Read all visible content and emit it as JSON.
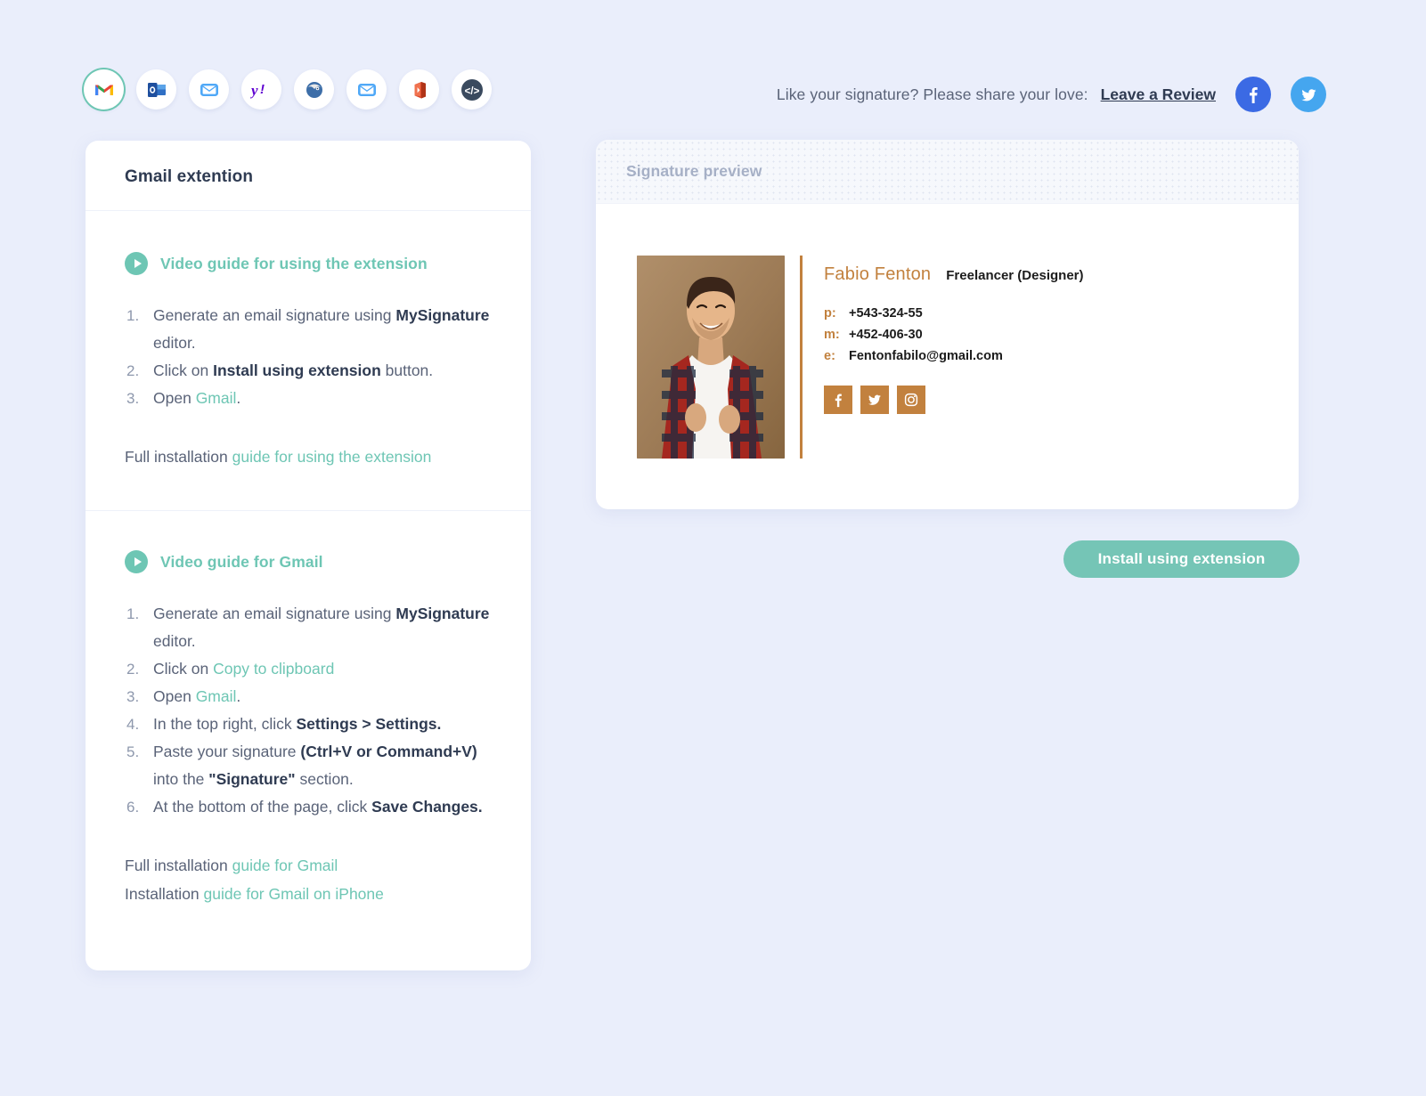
{
  "topbar": {
    "clients": [
      {
        "name": "gmail",
        "label": "Gmail",
        "active": true
      },
      {
        "name": "outlook",
        "label": "Outlook",
        "active": false
      },
      {
        "name": "apple-mail",
        "label": "Apple Mail",
        "active": false
      },
      {
        "name": "yahoo-mail",
        "label": "Yahoo Mail",
        "active": false
      },
      {
        "name": "thunderbird",
        "label": "Thunderbird",
        "active": false
      },
      {
        "name": "mail-app",
        "label": "Mail",
        "active": false
      },
      {
        "name": "office-365",
        "label": "Office 365",
        "active": false
      },
      {
        "name": "html-code",
        "label": "HTML code",
        "active": false
      }
    ],
    "share_prompt": "Like your signature? Please share your love:",
    "review_link": "Leave a Review",
    "facebook_icon": "facebook-icon",
    "twitter_icon": "twitter-icon"
  },
  "left_card": {
    "title": "Gmail extention",
    "sections": [
      {
        "video_label": "Video guide for using the extension",
        "steps": [
          {
            "parts": [
              {
                "t": "Generate an email signature using ",
                "s": "n"
              },
              {
                "t": "MySignature",
                "s": "b"
              },
              {
                "t": " editor.",
                "s": "n"
              }
            ]
          },
          {
            "parts": [
              {
                "t": "Click on ",
                "s": "n"
              },
              {
                "t": "Install using extension",
                "s": "b"
              },
              {
                "t": " button.",
                "s": "n"
              }
            ]
          },
          {
            "parts": [
              {
                "t": "Open ",
                "s": "n"
              },
              {
                "t": "Gmail",
                "s": "l"
              },
              {
                "t": ".",
                "s": "n"
              }
            ]
          }
        ],
        "footer": [
          {
            "prefix": "Full installation ",
            "link": "guide for using the extension"
          }
        ]
      },
      {
        "video_label": "Video guide for Gmail",
        "steps": [
          {
            "parts": [
              {
                "t": "Generate an email signature using ",
                "s": "n"
              },
              {
                "t": "MySignature",
                "s": "b"
              },
              {
                "t": " editor.",
                "s": "n"
              }
            ]
          },
          {
            "parts": [
              {
                "t": "Click on ",
                "s": "n"
              },
              {
                "t": "Copy to clipboard",
                "s": "l"
              }
            ]
          },
          {
            "parts": [
              {
                "t": "Open ",
                "s": "n"
              },
              {
                "t": "Gmail",
                "s": "l"
              },
              {
                "t": ".",
                "s": "n"
              }
            ]
          },
          {
            "parts": [
              {
                "t": "In the top right, click ",
                "s": "n"
              },
              {
                "t": "Settings > Settings.",
                "s": "b"
              }
            ]
          },
          {
            "parts": [
              {
                "t": "Paste your signature ",
                "s": "n"
              },
              {
                "t": "(Ctrl+V or Command+V)",
                "s": "b"
              },
              {
                "t": " into the ",
                "s": "n"
              },
              {
                "t": "\"Signature\"",
                "s": "b"
              },
              {
                "t": " section.",
                "s": "n"
              }
            ]
          },
          {
            "parts": [
              {
                "t": "At the bottom of the page, click ",
                "s": "n"
              },
              {
                "t": "Save Changes.",
                "s": "b"
              }
            ]
          }
        ],
        "footer": [
          {
            "prefix": "Full installation ",
            "link": "guide for Gmail"
          },
          {
            "prefix": "Installation ",
            "link": "guide for Gmail on iPhone"
          }
        ]
      }
    ]
  },
  "preview": {
    "header_title": "Signature preview",
    "signature": {
      "photo_alt": "portrait-photo",
      "name": "Fabio Fenton",
      "role": "Freelancer (Designer)",
      "contacts": [
        {
          "label": "p:",
          "value": "+543-324-55"
        },
        {
          "label": "m:",
          "value": "+452-406-30"
        },
        {
          "label": "e:",
          "value": "Fentonfabilo@gmail.com"
        }
      ],
      "socials": [
        {
          "name": "facebook-icon"
        },
        {
          "name": "twitter-icon"
        },
        {
          "name": "instagram-icon"
        }
      ]
    }
  },
  "actions": {
    "install_label": "Install using extension"
  },
  "colors": {
    "page_bg": "#eaeefb",
    "accent_teal": "#6ec6b4",
    "button_teal": "#75c5b6",
    "signature_orange": "#c2813e",
    "text_dark": "#2f3b52",
    "text_body": "#5a6378",
    "preview_header_text": "#a6b0c6"
  }
}
